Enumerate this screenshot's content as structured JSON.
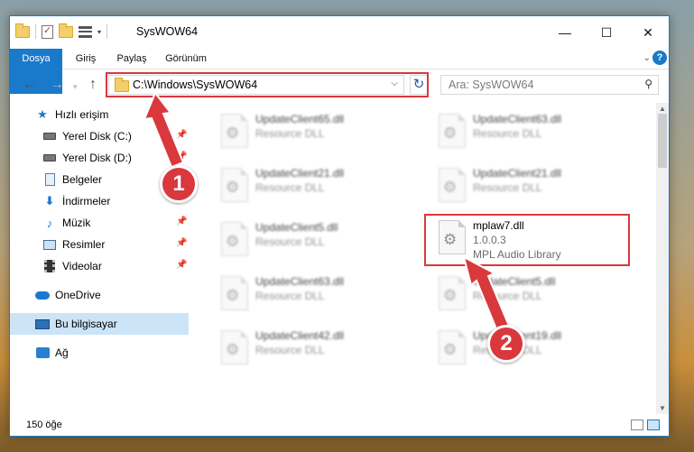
{
  "window": {
    "title": "SysWOW64",
    "controls": {
      "minimize": "—",
      "maximize": "☐",
      "close": "✕"
    }
  },
  "ribbon": {
    "tabs": [
      "Dosya",
      "Giriş",
      "Paylaş",
      "Görünüm"
    ]
  },
  "navigation": {
    "back": "←",
    "forward": "→",
    "up": "↑",
    "address": "C:\\Windows\\SysWOW64",
    "refresh": "↻",
    "search_placeholder": "Ara: SysWOW64"
  },
  "sidebar": {
    "items": [
      {
        "label": "Hızlı erişim",
        "icon": "star-icon"
      },
      {
        "label": "Yerel Disk (C:)",
        "icon": "disk-icon",
        "pinned": true
      },
      {
        "label": "Yerel Disk (D:)",
        "icon": "disk-icon",
        "pinned": true
      },
      {
        "label": "Belgeler",
        "icon": "document-icon",
        "pinned": true
      },
      {
        "label": "İndirmeler",
        "icon": "download-icon",
        "pinned": true
      },
      {
        "label": "Müzik",
        "icon": "music-icon",
        "pinned": true
      },
      {
        "label": "Resimler",
        "icon": "pictures-icon",
        "pinned": true
      },
      {
        "label": "Videolar",
        "icon": "video-icon",
        "pinned": true
      },
      {
        "label": "OneDrive",
        "icon": "onedrive-icon"
      },
      {
        "label": "Bu bilgisayar",
        "icon": "computer-icon",
        "selected": true
      },
      {
        "label": "Ağ",
        "icon": "network-icon"
      }
    ]
  },
  "files": [
    {
      "name": "UpdateClient65.dll",
      "type": "Resource DLL",
      "blurred": true
    },
    {
      "name": "UpdateClient63.dll",
      "type": "Resource DLL",
      "blurred": true
    },
    {
      "name": "UpdateClient21.dll",
      "type": "Resource DLL",
      "blurred": true
    },
    {
      "name": "UpdateClient21.dll",
      "type": "Resource DLL",
      "blurred": true
    },
    {
      "name": "UpdateClient5.dll",
      "type": "Resource DLL",
      "blurred": true
    },
    {
      "name": "mplaw7.dll",
      "version": "1.0.0.3",
      "type": "MPL Audio Library",
      "blurred": false
    },
    {
      "name": "UpdateClient63.dll",
      "type": "Resource DLL",
      "blurred": true
    },
    {
      "name": "UpdateClient5.dll",
      "type": "Resource DLL",
      "blurred": true
    },
    {
      "name": "UpdateClient42.dll",
      "type": "Resource DLL",
      "blurred": true
    },
    {
      "name": "UpdateClient19.dll",
      "type": "Resource DLL",
      "blurred": true
    }
  ],
  "status": {
    "item_count": "150 öğe"
  },
  "annotations": {
    "badge1": "1",
    "badge2": "2",
    "color": "#d9383d"
  }
}
